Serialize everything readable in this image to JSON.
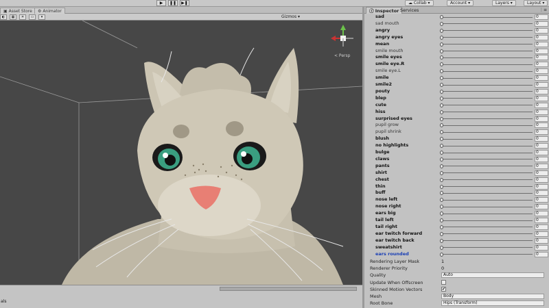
{
  "top_bar": {
    "play_icon": "play-icon",
    "pause_icon": "pause-icon",
    "step_icon": "step-icon",
    "collab_label": "Collab",
    "account_label": "Account",
    "layers_label": "Layers",
    "layout_label": "Layout"
  },
  "scene_tabs": [
    {
      "label": "Asset Store"
    },
    {
      "label": "Animator"
    }
  ],
  "scene_toolbar": {
    "gizmos_label": "Gizmos"
  },
  "viewport": {
    "persp_label": "< Persp",
    "background_color": "#474747"
  },
  "bottom_strip": {
    "label": "als"
  },
  "inspector": {
    "tabs": [
      {
        "label": "Inspector",
        "active": true
      },
      {
        "label": "Services",
        "active": false
      }
    ],
    "blendshapes": [
      {
        "label": "sad",
        "value": "0",
        "style": "bold"
      },
      {
        "label": "sad mouth",
        "value": "0",
        "style": "light"
      },
      {
        "label": "angry",
        "value": "0",
        "style": "bold"
      },
      {
        "label": "angry eyes",
        "value": "0",
        "style": "bold"
      },
      {
        "label": "mean",
        "value": "0",
        "style": "bold"
      },
      {
        "label": "smile mouth",
        "value": "0",
        "style": "light"
      },
      {
        "label": "smile eyes",
        "value": "0",
        "style": "bold"
      },
      {
        "label": "smile eye.R",
        "value": "0",
        "style": "bold"
      },
      {
        "label": "smile eye.L",
        "value": "0",
        "style": "light"
      },
      {
        "label": "smile",
        "value": "0",
        "style": "bold"
      },
      {
        "label": "smile2",
        "value": "0",
        "style": "bold"
      },
      {
        "label": "pouty",
        "value": "0",
        "style": "bold"
      },
      {
        "label": "blep",
        "value": "0",
        "style": "bold"
      },
      {
        "label": "cute",
        "value": "0",
        "style": "bold"
      },
      {
        "label": "hiss",
        "value": "0",
        "style": "bold"
      },
      {
        "label": "surprised eyes",
        "value": "0",
        "style": "bold"
      },
      {
        "label": "pupil grow",
        "value": "0",
        "style": "light"
      },
      {
        "label": "pupil shrink",
        "value": "0",
        "style": "light"
      },
      {
        "label": "blush",
        "value": "0",
        "style": "bold"
      },
      {
        "label": "no highlights",
        "value": "0",
        "style": "bold"
      },
      {
        "label": "bulge",
        "value": "0",
        "style": "bold"
      },
      {
        "label": "claws",
        "value": "0",
        "style": "bold"
      },
      {
        "label": "pants",
        "value": "0",
        "style": "bold"
      },
      {
        "label": "shirt",
        "value": "0",
        "style": "bold"
      },
      {
        "label": "chest",
        "value": "0",
        "style": "bold"
      },
      {
        "label": "thin",
        "value": "0",
        "style": "bold"
      },
      {
        "label": "buff",
        "value": "0",
        "style": "bold"
      },
      {
        "label": "nose left",
        "value": "0",
        "style": "bold"
      },
      {
        "label": "nose right",
        "value": "0",
        "style": "bold"
      },
      {
        "label": "ears big",
        "value": "0",
        "style": "bold"
      },
      {
        "label": "tail left",
        "value": "0",
        "style": "bold"
      },
      {
        "label": "tail right",
        "value": "0",
        "style": "bold"
      },
      {
        "label": "ear twitch forward",
        "value": "0",
        "style": "bold"
      },
      {
        "label": "ear twitch back",
        "value": "0",
        "style": "bold"
      },
      {
        "label": "sweatshirt",
        "value": "0",
        "style": "bold"
      },
      {
        "label": "ears rounded",
        "value": "0",
        "style": "blue"
      }
    ],
    "properties": [
      {
        "label": "Rendering Layer Mask",
        "value": "1",
        "kind": "text"
      },
      {
        "label": "Renderer Priority",
        "value": "0",
        "kind": "text"
      },
      {
        "label": "Quality",
        "value": "Auto",
        "kind": "field"
      },
      {
        "label": "Update When Offscreen",
        "value": "",
        "kind": "checkbox"
      },
      {
        "label": "Skinned Motion Vectors",
        "value": "✔",
        "kind": "checkbox"
      },
      {
        "label": "Mesh",
        "value": "Body",
        "kind": "field"
      },
      {
        "label": "Root Bone",
        "value": "Hips (Transform)",
        "kind": "field"
      }
    ]
  }
}
